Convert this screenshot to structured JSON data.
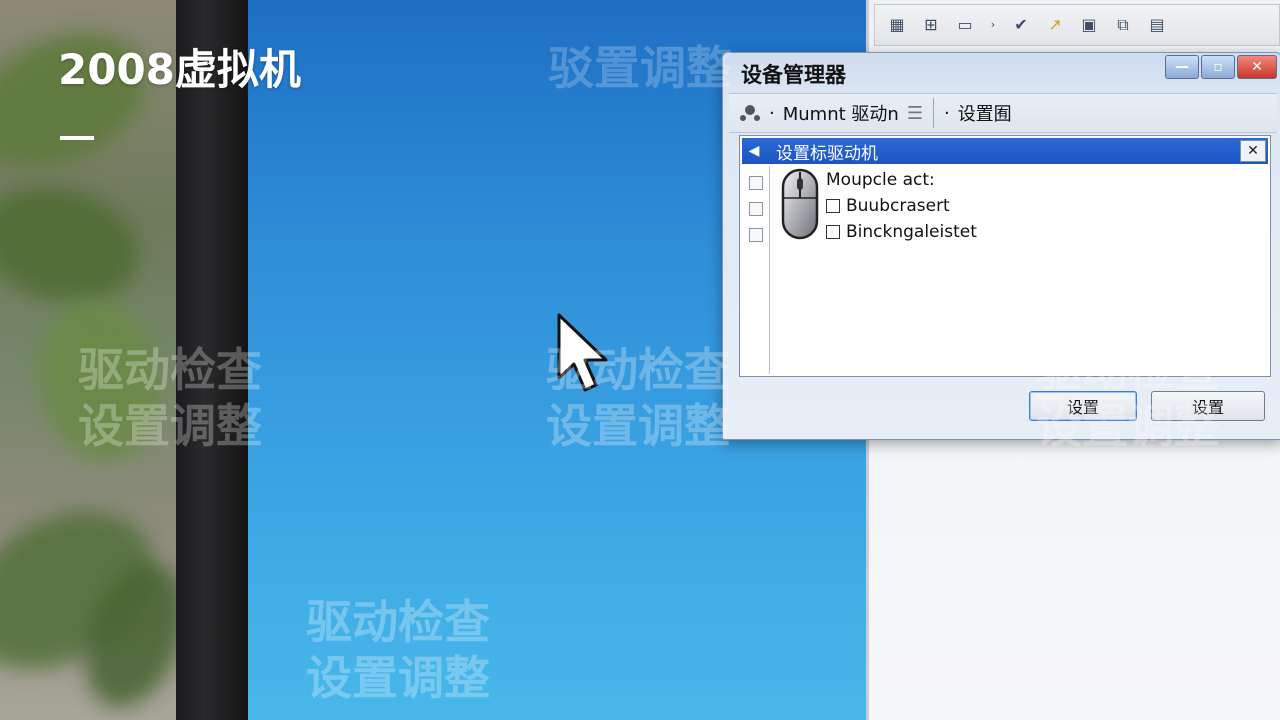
{
  "overlay": {
    "title": "2008虚拟机",
    "watermark_top": "驳置调整",
    "watermark_line1": "驱动检查",
    "watermark_line2": "设置调整"
  },
  "dialog": {
    "title": "设备管理器",
    "window_buttons": {
      "minimize": "—",
      "maximize": "▫",
      "close": "✕"
    },
    "menu": {
      "item1": "Mumnt 驱动n",
      "item2": "设置囿"
    },
    "panel": {
      "header": "设置标驱动机",
      "items": [
        {
          "label": "Moupcle act:"
        },
        {
          "label": "Buubcrasert"
        },
        {
          "label": "Binckngaleistet"
        }
      ]
    },
    "ok_label": "设置",
    "cancel_label": "设置"
  },
  "toolbar_icons": [
    "grid-icon",
    "arrange-icon",
    "window-icon",
    "chevron-icon",
    "check-icon",
    "share-icon",
    "save-icon",
    "copy-icon",
    "paste-icon"
  ]
}
